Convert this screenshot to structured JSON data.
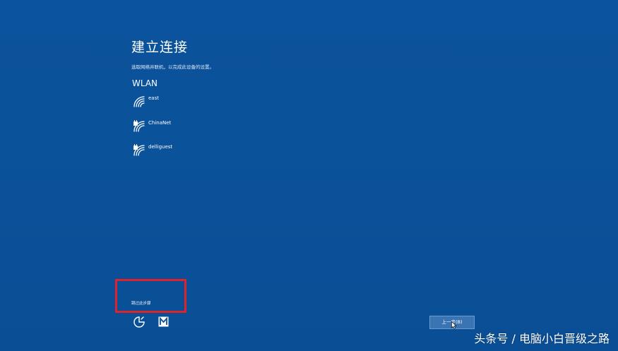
{
  "page": {
    "title": "建立连接",
    "subtitle": "选取网络并联机，以完成此设备的设置。",
    "section_label": "WLAN"
  },
  "networks": [
    {
      "name": "east",
      "icon": "wifi-icon"
    },
    {
      "name": "ChinaNet",
      "icon": "wifi-secured-icon"
    },
    {
      "name": "delliguest",
      "icon": "wifi-secured-icon"
    }
  ],
  "footer": {
    "skip_label": "跳过此步骤",
    "ease_of_access_icon": "ease-of-access-icon",
    "narrator_icon": "narrator-icon",
    "back_label": "上一步(B)"
  },
  "watermark": "头条号 / 电脑小白晋级之路",
  "colors": {
    "background": "#0a5199",
    "highlight": "#e1212b",
    "button": "#3b74b2",
    "text": "#ffffff"
  }
}
